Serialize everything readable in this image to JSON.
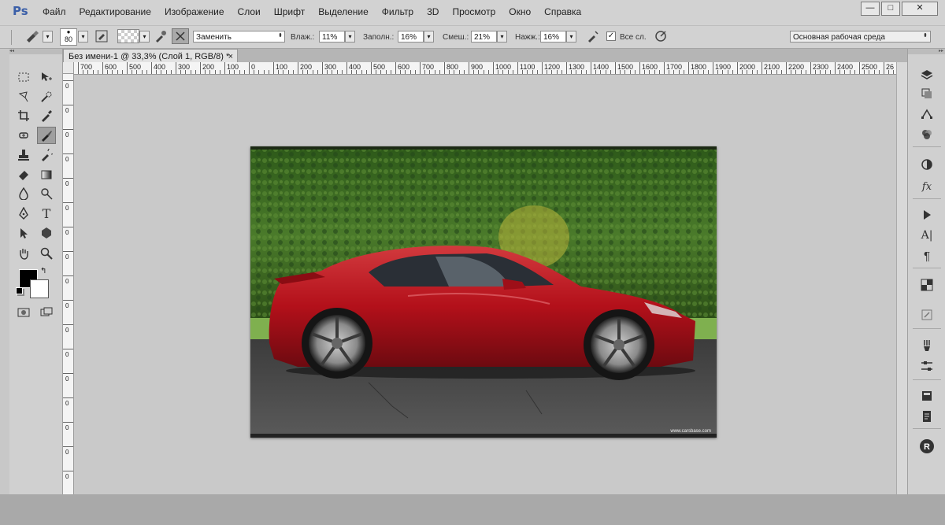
{
  "app": {
    "logo": "Ps"
  },
  "menu": [
    "Файл",
    "Редактирование",
    "Изображение",
    "Слои",
    "Шрифт",
    "Выделение",
    "Фильтр",
    "3D",
    "Просмотр",
    "Окно",
    "Справка"
  ],
  "options": {
    "brush_size": "80",
    "mode_value": "Заменить",
    "flow_label": "Влаж.:",
    "flow_value": "11%",
    "fill_label": "Заполн.:",
    "fill_value": "16%",
    "mix_label": "Смеш.:",
    "mix_value": "21%",
    "strength_label": "Нажж.:",
    "strength_value": "16%",
    "all_layers_label": "Все сл.",
    "workspace_value": "Основная рабочая среда"
  },
  "document": {
    "tab_title": "Без имени-1 @ 33,3% (Слой 1, RGB/8) *",
    "close_glyph": "×"
  },
  "ruler": {
    "labels": [
      "700",
      "600",
      "500",
      "400",
      "300",
      "200",
      "100",
      "0",
      "100",
      "200",
      "300",
      "400",
      "500",
      "600",
      "700",
      "800",
      "900",
      "1000",
      "1100",
      "1200",
      "1300",
      "1400",
      "1500",
      "1600",
      "1700",
      "1800",
      "1900",
      "2000",
      "2100",
      "2200",
      "2300",
      "2400",
      "2500",
      "26"
    ],
    "v_labels": [
      "0",
      "0",
      "0",
      "0",
      "0",
      "0",
      "0",
      "0",
      "0",
      "0",
      "0",
      "0",
      "0",
      "0",
      "0",
      "0",
      "0",
      "0"
    ]
  },
  "colors": {
    "foreground": "#000000",
    "background": "#ffffff",
    "car_red": "#b3101a",
    "hedge": "#3f6a22"
  },
  "photo": {
    "watermark": "www.carsbase.com"
  },
  "window_controls": {
    "minimize": "—",
    "maximize": "□",
    "close": "✕"
  }
}
